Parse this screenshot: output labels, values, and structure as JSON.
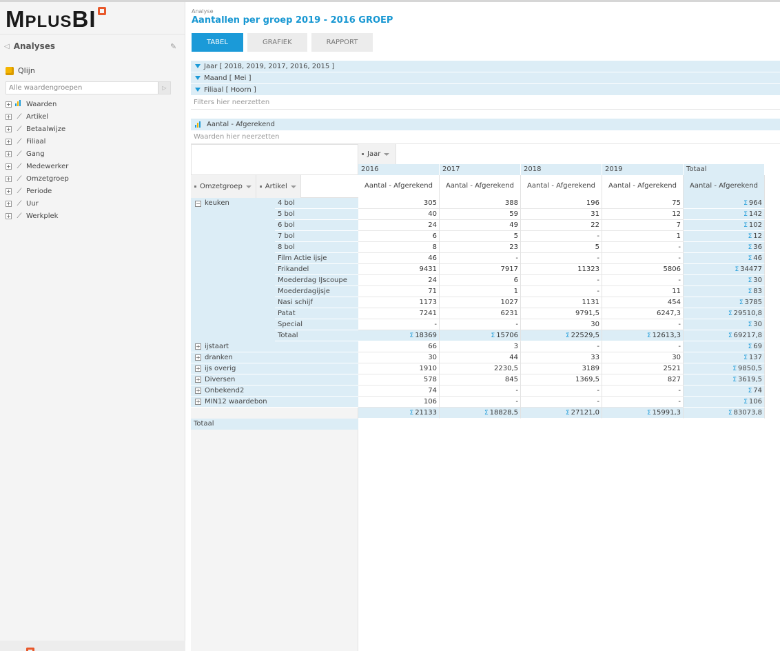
{
  "app": {
    "logo_big_M": "M",
    "logo_small_plus": "PLUS",
    "logo_big_BI": "BI"
  },
  "sidebar": {
    "title": "Analyses",
    "cube_name": "Qlijn",
    "search_placeholder": "Alle waardengroepen",
    "items": [
      {
        "label": "Waarden",
        "icon": "bar-chart-icon"
      },
      {
        "label": "Artikel",
        "icon": "dimension-icon"
      },
      {
        "label": "Betaalwijze",
        "icon": "dimension-icon"
      },
      {
        "label": "Filiaal",
        "icon": "dimension-icon"
      },
      {
        "label": "Gang",
        "icon": "dimension-icon"
      },
      {
        "label": "Medewerker",
        "icon": "dimension-icon"
      },
      {
        "label": "Omzetgroep",
        "icon": "dimension-icon"
      },
      {
        "label": "Periode",
        "icon": "dimension-icon"
      },
      {
        "label": "Uur",
        "icon": "dimension-icon"
      },
      {
        "label": "Werkplek",
        "icon": "dimension-icon"
      }
    ]
  },
  "header": {
    "breadcrumb": "Analyse",
    "title": "Aantallen per groep 2019 - 2016 GROEP"
  },
  "tabs": [
    {
      "label": "TABEL",
      "active": true
    },
    {
      "label": "GRAFIEK",
      "active": false
    },
    {
      "label": "RAPPORT",
      "active": false
    }
  ],
  "filters": [
    {
      "label": "Jaar  [ 2018, 2019, 2017, 2016, 2015 ]"
    },
    {
      "label": "Maand  [ Mei ]"
    },
    {
      "label": "Filiaal  [ Hoorn ]"
    }
  ],
  "filters_placeholder": "Filters hier neerzetten",
  "values_chip": "Aantal - Afgerekend",
  "values_placeholder": "Waarden hier neerzetten",
  "pivot": {
    "column_chip": "Jaar",
    "row_chips": [
      "Omzetgroep",
      "Artikel"
    ],
    "years": [
      "2016",
      "2017",
      "2018",
      "2019",
      "Totaal"
    ],
    "measure": "Aantal - Afgerekend",
    "keuken_label": "keuken",
    "keuken_rows": [
      {
        "artikel": "4 bol",
        "v": [
          "305",
          "388",
          "196",
          "75"
        ],
        "t": "964"
      },
      {
        "artikel": "5 bol",
        "v": [
          "40",
          "59",
          "31",
          "12"
        ],
        "t": "142"
      },
      {
        "artikel": "6 bol",
        "v": [
          "24",
          "49",
          "22",
          "7"
        ],
        "t": "102"
      },
      {
        "artikel": "7 bol",
        "v": [
          "6",
          "5",
          "-",
          "1"
        ],
        "t": "12"
      },
      {
        "artikel": "8 bol",
        "v": [
          "8",
          "23",
          "5",
          "-"
        ],
        "t": "36"
      },
      {
        "artikel": "Film Actie ijsje",
        "v": [
          "46",
          "-",
          "-",
          "-"
        ],
        "t": "46"
      },
      {
        "artikel": "Frikandel",
        "v": [
          "9431",
          "7917",
          "11323",
          "5806"
        ],
        "t": "34477"
      },
      {
        "artikel": "Moederdag IJscoupe",
        "v": [
          "24",
          "6",
          "-",
          "-"
        ],
        "t": "30"
      },
      {
        "artikel": "Moederdagijsje",
        "v": [
          "71",
          "1",
          "-",
          "11"
        ],
        "t": "83"
      },
      {
        "artikel": "Nasi schijf",
        "v": [
          "1173",
          "1027",
          "1131",
          "454"
        ],
        "t": "3785"
      },
      {
        "artikel": "Patat",
        "v": [
          "7241",
          "6231",
          "9791,5",
          "6247,3"
        ],
        "t": "29510,8"
      },
      {
        "artikel": "Special",
        "v": [
          "-",
          "-",
          "30",
          "-"
        ],
        "t": "30"
      }
    ],
    "keuken_total_label": "Totaal",
    "keuken_subtotal": {
      "v": [
        "18369",
        "15706",
        "22529,5",
        "12613,3"
      ],
      "t": "69217,8"
    },
    "groups": [
      {
        "label": "ijstaart",
        "v": [
          "66",
          "3",
          "-",
          "-"
        ],
        "t": "69"
      },
      {
        "label": "dranken",
        "v": [
          "30",
          "44",
          "33",
          "30"
        ],
        "t": "137"
      },
      {
        "label": "ijs overig",
        "v": [
          "1910",
          "2230,5",
          "3189",
          "2521"
        ],
        "t": "9850,5"
      },
      {
        "label": "Diversen",
        "v": [
          "578",
          "845",
          "1369,5",
          "827"
        ],
        "t": "3619,5"
      },
      {
        "label": "Onbekend2",
        "v": [
          "74",
          "-",
          "-",
          "-"
        ],
        "t": "74"
      },
      {
        "label": "MIN12 waardebon",
        "v": [
          "106",
          "-",
          "-",
          "-"
        ],
        "t": "106"
      }
    ],
    "grand_total_label": "Totaal",
    "grand_total": {
      "v": [
        "21133",
        "18828,5",
        "27121,0",
        "15991,3"
      ],
      "t": "83073,8"
    },
    "sigma": "Σ"
  }
}
